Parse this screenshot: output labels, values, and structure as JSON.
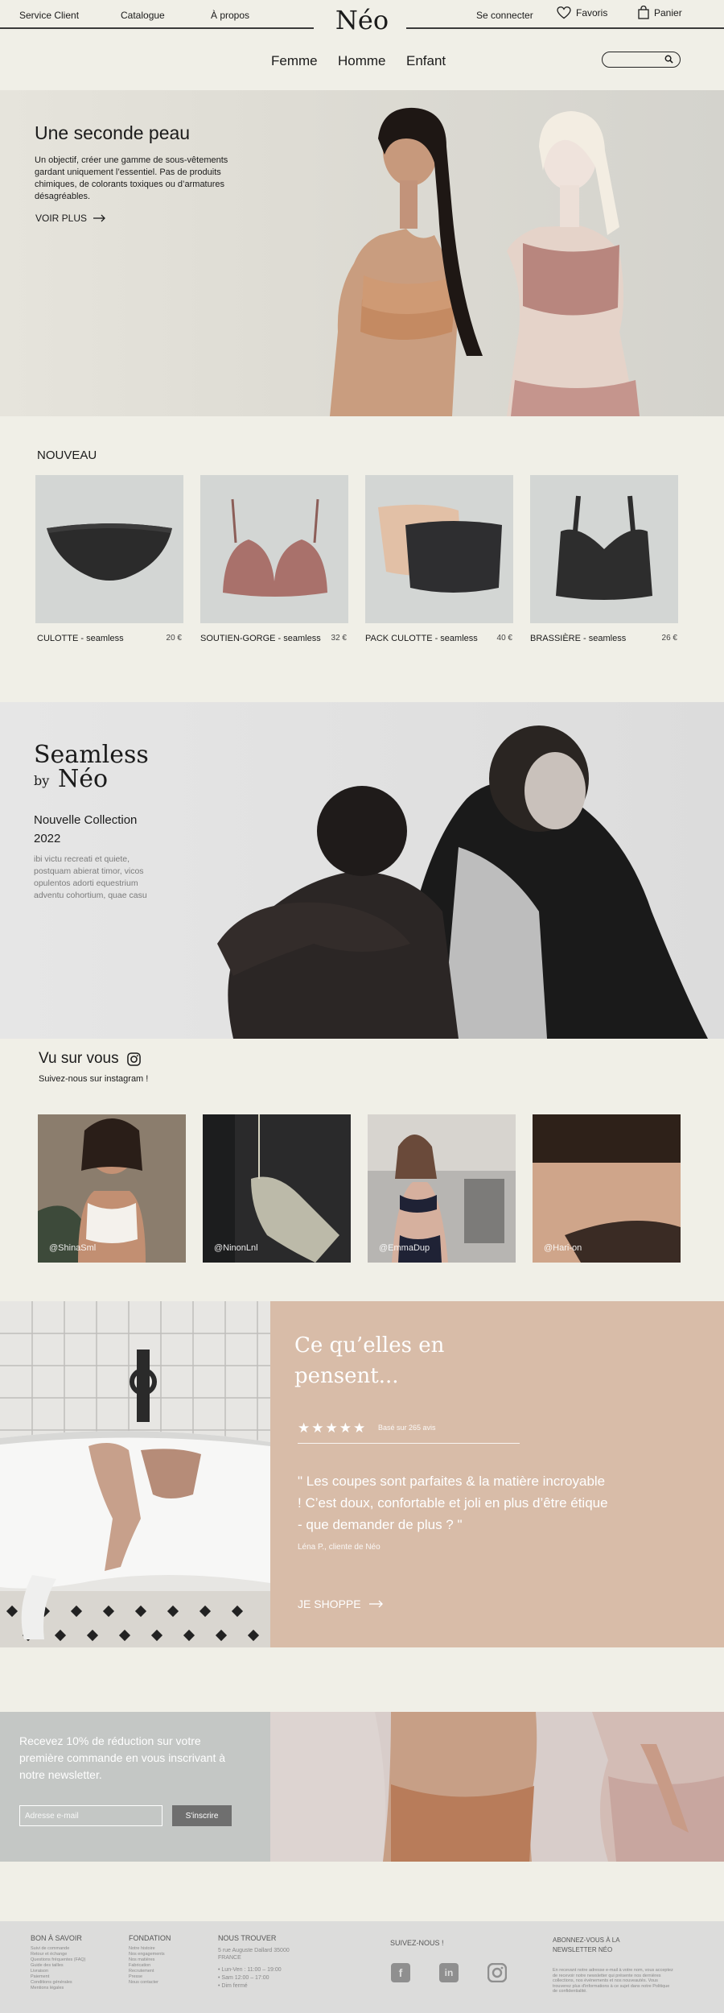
{
  "topbar": {
    "links": [
      "Service Client",
      "Catalogue",
      "À propos"
    ],
    "brand": "Néo",
    "signin": "Se connecter",
    "favorites": "Favoris",
    "cart": "Panier"
  },
  "nav": {
    "items": [
      "Femme",
      "Homme",
      "Enfant"
    ]
  },
  "search": {
    "placeholder": ""
  },
  "hero": {
    "title": "Une seconde peau",
    "text": "Un objectif, créer une gamme de sous-vêtements gardant uniquement l’essentiel. Pas de produits chimiques, de colorants toxiques ou d’armatures désagréables.",
    "cta": "VOIR PLUS"
  },
  "nouveau": {
    "title": "NOUVEAU",
    "products": [
      {
        "name": "CULOTTE - seamless",
        "price": "20 €"
      },
      {
        "name": "SOUTIEN-GORGE - seamless",
        "price": "32 €"
      },
      {
        "name": "PACK CULOTTE - seamless",
        "price": "40 €"
      },
      {
        "name": "BRASSIÈRE - seamless",
        "price": "26 €"
      }
    ]
  },
  "seamless": {
    "title": "Seamless",
    "by": "by",
    "brand": "Néo",
    "collection": "Nouvelle Collection 2022",
    "text": "ibi victu recreati et quiete, postquam abierat timor, vicos opulentos adorti equestrium adventu cohortium, quae casu"
  },
  "instagram": {
    "title": "Vu sur vous",
    "subtitle": "Suivez-nous sur instagram !",
    "posts": [
      "@ShinaSml",
      "@NinonLnl",
      "@EmmaDup",
      "@Hari-on"
    ]
  },
  "testimonial": {
    "heading": "Ce qu’elles en pensent...",
    "stars": 5,
    "base": "Basé sur 265 avis",
    "quote": "\" Les coupes sont parfaites & la matière incroyable ! C’est doux, confortable et joli en plus d’être étique - que demander de plus ? \"",
    "author": "Léna P., cliente de Néo",
    "cta": "JE SHOPPE"
  },
  "newsletter": {
    "text": "Recevez 10% de réduction sur votre première commande en vous inscrivant à notre newsletter.",
    "placeholder": "Adresse e-mail",
    "button": "S'inscrire"
  },
  "footer": {
    "col1": {
      "title": "BON À SAVOIR",
      "items": [
        "Suivi de commande",
        "Retour et échange",
        "Questions fréquentes (FAQ)",
        "Guide des tailles",
        "Livraison",
        "Paiement",
        "Conditions générales",
        "Mentions légales"
      ]
    },
    "col2": {
      "title": "FONDATION",
      "items": [
        "Notre histoire",
        "Nos engagements",
        "Nos matières",
        "Fabrication",
        "Recrutement",
        "Presse",
        "Nous contacter"
      ]
    },
    "col3": {
      "title": "NOUS TROUVER",
      "address": [
        "5 rue Auguste Dallard 35000",
        "FRANCE"
      ],
      "hours": [
        "Lun-Ven : 11:00 – 19:00",
        "Sam 12:00 – 17:00",
        "Dim fermé"
      ]
    },
    "social": {
      "title": "SUIVEZ-NOUS !",
      "icons": [
        "facebook-icon",
        "linkedin-icon",
        "instagram-icon"
      ]
    },
    "news": {
      "title": "ABONNEZ-VOUS À LA NEWSLETTER NÉO",
      "text": "En recevant notre adresse e-mail à votre nom, vous acceptez de recevoir notre newsletter qui présente nos dernières collections, nos événements et nos nouveautés. Vous trouverez plus d'informations à ce sujet dans notre Politique de confidentialité."
    }
  },
  "colors": {
    "background": "#f0efe7",
    "testimonial_panel": "#d8bca8",
    "newsletter_panel": "#c4c7c5",
    "footer": "#dcdcdb"
  }
}
